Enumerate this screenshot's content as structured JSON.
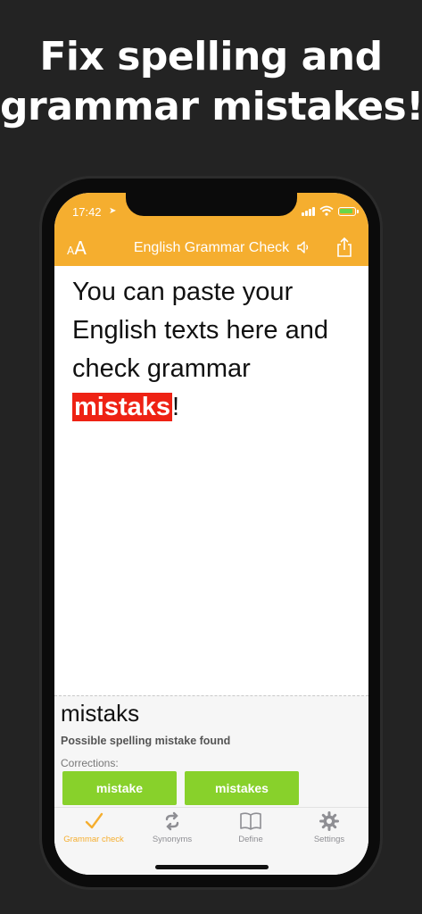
{
  "headline": {
    "line1": "Fix spelling and",
    "line2": "grammar mistakes!"
  },
  "status_bar": {
    "time": "17:42"
  },
  "nav": {
    "font_icon_small": "A",
    "font_icon_big": "A",
    "title": "English Grammar Check"
  },
  "editor": {
    "text_before": "You can paste your English texts here and check grammar ",
    "error_word": "mistaks",
    "text_after": "!"
  },
  "suggestion": {
    "word": "mistaks",
    "message": "Possible spelling mistake found",
    "corrections_label": "Corrections:",
    "corrections": [
      "mistake",
      "mistakes"
    ]
  },
  "tabs": [
    {
      "label": "Grammar check",
      "icon": "checkmark-icon",
      "active": true
    },
    {
      "label": "Synonyms",
      "icon": "refresh-icon",
      "active": false
    },
    {
      "label": "Define",
      "icon": "book-icon",
      "active": false
    },
    {
      "label": "Settings",
      "icon": "gear-icon",
      "active": false
    }
  ],
  "colors": {
    "accent": "#f5ae2f",
    "error": "#ee2214",
    "correction": "#88d12b",
    "background": "#232323"
  }
}
